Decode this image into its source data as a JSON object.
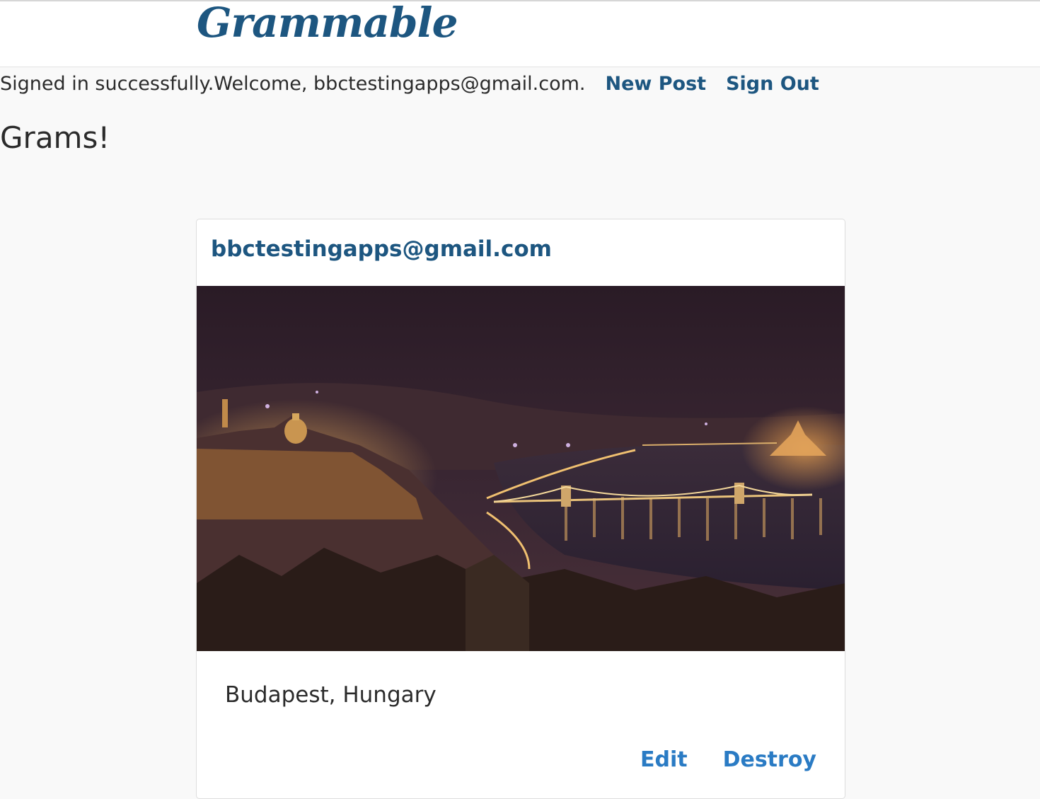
{
  "header": {
    "brand": "Grammable"
  },
  "status": {
    "notice": "Signed in successfully.",
    "welcome": "Welcome, bbctestingapps@gmail.com.",
    "new_post": "New Post",
    "sign_out": "Sign Out"
  },
  "page": {
    "title": "Grams!"
  },
  "grams": [
    {
      "author": "bbctestingapps@gmail.com",
      "caption": "Budapest, Hungary",
      "edit_label": "Edit",
      "destroy_label": "Destroy"
    }
  ],
  "colors": {
    "brand": "#1d5680",
    "action_link": "#2a7bc4",
    "page_background": "#f9f9f9"
  }
}
